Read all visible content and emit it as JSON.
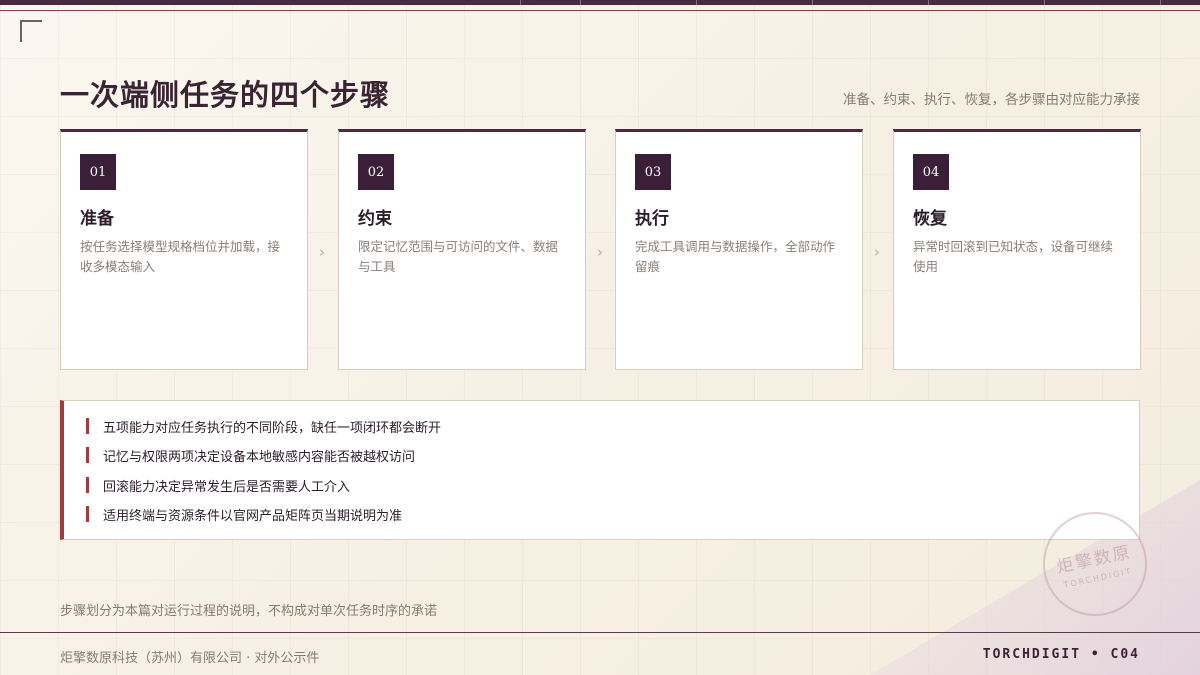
{
  "header": {
    "title": "一次端侧任务的四个步骤",
    "subtitle": "准备、约束、执行、恢复，各步骤由对应能力承接"
  },
  "steps": [
    {
      "num": "01",
      "title": "准备",
      "desc": "按任务选择模型规格档位并加载，接收多模态输入"
    },
    {
      "num": "02",
      "title": "约束",
      "desc": "限定记忆范围与可访问的文件、数据与工具"
    },
    {
      "num": "03",
      "title": "执行",
      "desc": "完成工具调用与数据操作，全部动作留痕"
    },
    {
      "num": "04",
      "title": "恢复",
      "desc": "异常时回滚到已知状态，设备可继续使用"
    }
  ],
  "notes": [
    "五项能力对应任务执行的不同阶段，缺任一项闭环都会断开",
    "记忆与权限两项决定设备本地敏感内容能否被越权访问",
    "回滚能力决定异常发生后是否需要人工介入",
    "适用终端与资源条件以官网产品矩阵页当期说明为准"
  ],
  "footnote": "步骤划分为本篇对运行过程的说明，不构成对单次任务时序的承诺",
  "footer": {
    "left": "炬擎数原科技（苏州）有限公司 · 对外公示件",
    "right": "TORCHDIGIT • C04"
  },
  "seal": {
    "line1": "炬擎数原",
    "line2": "TORCHDIGIT"
  },
  "icons": {
    "step_arrow": "chevron-right-icon",
    "corner": "corner-bracket-icon"
  },
  "colors": {
    "primary": "#3b1f38",
    "accent": "#a33a3f",
    "background": "#f6f0e3"
  }
}
